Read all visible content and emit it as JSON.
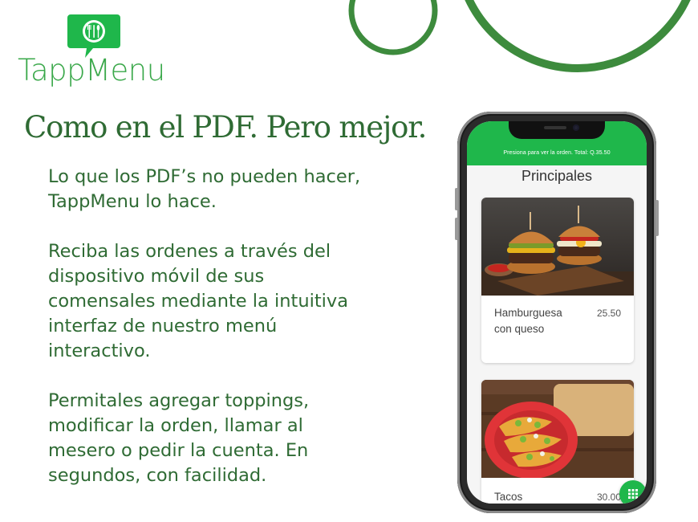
{
  "colors": {
    "brand_green": "#3aa84a",
    "headline_green": "#2f6b34",
    "deco_green": "#3d8b3d",
    "app_green": "#1fb74b"
  },
  "logo": {
    "text": "TappMenu",
    "icon": "fork-knife-spoon-chat-bubble-icon"
  },
  "headline": "Como en el PDF. Pero mejor.",
  "paragraphs": [
    "Lo que los PDF’s no pueden hacer, TappMenu lo hace.",
    "Reciba las ordenes a través del dispositivo móvil de sus comensales mediante la intuitiva interfaz de nuestro menú interactivo.",
    "Permitales agregar toppings, modificar la orden, llamar al mesero o pedir la cuenta.  En segundos, con facilidad."
  ],
  "app": {
    "topbar_text": "Presiona para ver la orden. Total: Q.35.50",
    "section_title": "Principales",
    "items": [
      {
        "name": "Hamburguesa con queso",
        "price": "25.50",
        "image": "burgers-photo"
      },
      {
        "name": "Tacos",
        "price": "30.00",
        "image": "tacos-photo"
      }
    ],
    "fab_icon": "grid-menu-icon"
  }
}
